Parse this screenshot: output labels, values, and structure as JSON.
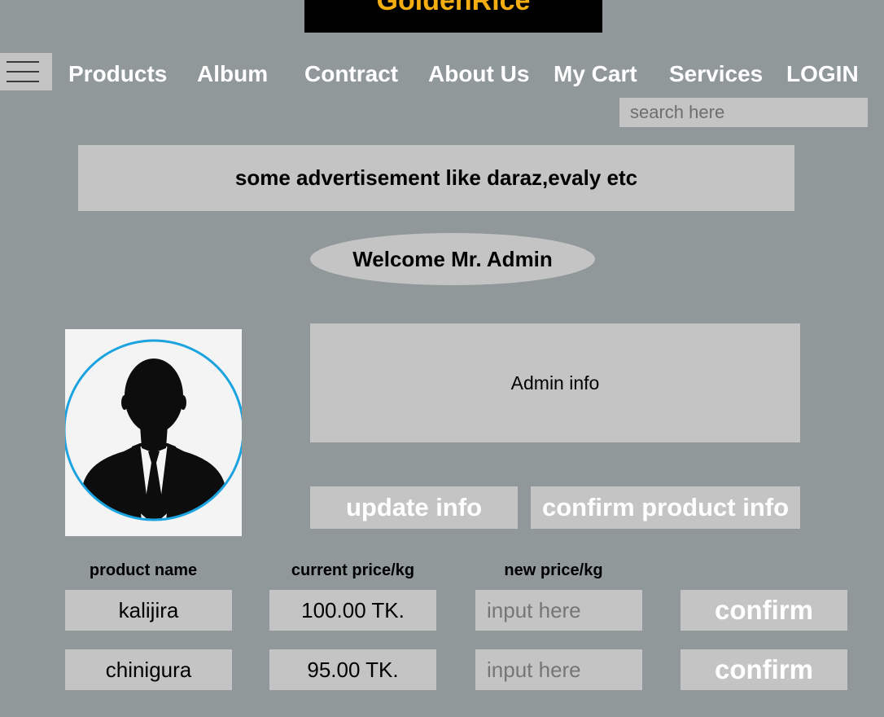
{
  "brand": {
    "name": "GoldenRice"
  },
  "nav": {
    "items": [
      {
        "label": "Products"
      },
      {
        "label": "Album"
      },
      {
        "label": "Contract"
      },
      {
        "label": "About Us"
      },
      {
        "label": "My Cart"
      },
      {
        "label": "Services"
      },
      {
        "label": "LOGIN"
      }
    ]
  },
  "search": {
    "placeholder": "search here",
    "value": ""
  },
  "advertisement": {
    "text": "some advertisement like daraz,evaly etc"
  },
  "welcome": {
    "text": "Welcome Mr. Admin"
  },
  "admin_info": {
    "text": "Admin info"
  },
  "actions": {
    "update_label": "update info",
    "confirm_product_label": "confirm product info"
  },
  "table": {
    "headers": {
      "name": "product name",
      "current": "current price/kg",
      "new": "new price/kg"
    },
    "rows": [
      {
        "name": "kalijira",
        "current_price": "100.00 TK.",
        "new_price_placeholder": "input here",
        "confirm_label": "confirm"
      },
      {
        "name": "chinigura",
        "current_price": "95.00 TK.",
        "new_price_placeholder": "input here",
        "confirm_label": "confirm"
      }
    ]
  },
  "colors": {
    "background": "#90989a",
    "panel": "#c4c4c4",
    "brand_bar": "#000000",
    "brand_text": "#f4ae12",
    "avatar_ring": "#1ba3e0"
  },
  "icons": {
    "menu": "hamburger-icon",
    "avatar": "user-silhouette-icon"
  }
}
